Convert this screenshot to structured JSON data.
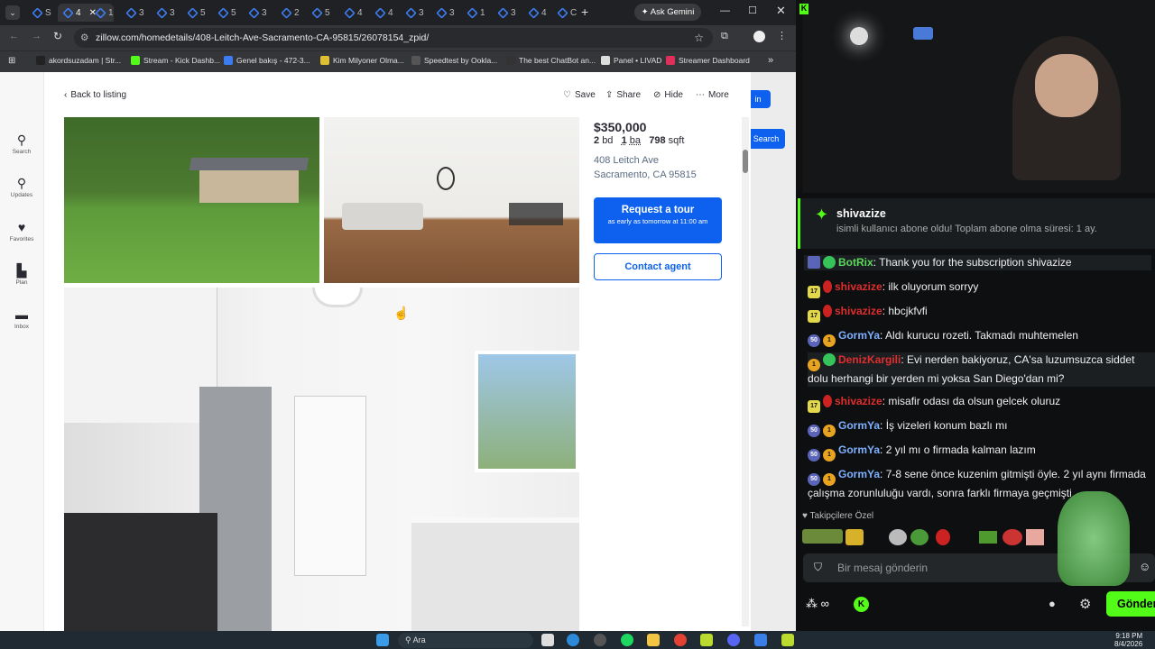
{
  "browser": {
    "tabs": [
      "S",
      "4",
      "1",
      "3",
      "3",
      "5",
      "5",
      "3",
      "2",
      "5",
      "4",
      "4",
      "3",
      "3",
      "1",
      "3",
      "4",
      "C"
    ],
    "gemini": "Ask Gemini",
    "url": "zillow.com/homedetails/408-Leitch-Ave-Sacramento-CA-95815/26078154_zpid/",
    "bookmarks": [
      "akordsuzadam | Str...",
      "Stream - Kick Dashb...",
      "Genel bakış - 472-3...",
      "Kim Milyoner Olma...",
      "Speedtest by Ookla...",
      "The best ChatBot an...",
      "Panel • LIVAD",
      "Streamer Dashboard"
    ]
  },
  "leftnav": [
    "Search",
    "Updates",
    "Favorites",
    "Plan",
    "Inbox"
  ],
  "modal": {
    "back": "Back to listing",
    "actions": [
      "Save",
      "Share",
      "Hide",
      "More"
    ],
    "price": "$350,000",
    "beds": "2",
    "beds_unit": "bd",
    "baths": "1",
    "baths_unit": "ba",
    "sqft": "798",
    "sqft_unit": "sqft",
    "addr1": "408 Leitch Ave",
    "addr2": "Sacramento, CA 95815",
    "tour": "Request a tour",
    "tour_sub": "as early as tomorrow at 11:00 am",
    "agent": "Contact agent"
  },
  "behind": {
    "signin": "in",
    "search": "Search"
  },
  "chat": {
    "sub_user": "shivazize",
    "sub_text": "isimli kullanıcı abone oldu! Toplam abone olma süresi: 1 ay.",
    "messages": [
      {
        "user": "BotRix",
        "text": ": Thank you for the subscription shivazize",
        "color": "#5cd85c"
      },
      {
        "user": "shivazize",
        "text": ": ilk oluyorum sorryy",
        "color": "#e02e2e",
        "badge": "17"
      },
      {
        "user": "shivazize",
        "text": ": hbcjkfvfi",
        "color": "#e02e2e",
        "badge": "17"
      },
      {
        "user": "GormYa",
        "text": ": Aldı kurucu rozeti. Takmadı muhtemelen",
        "color": "#7fb0ff",
        "badge": "50"
      },
      {
        "user": "DenizKargili",
        "text": ": Evi nerden bakiyoruz, CA'sa luzumsuzca siddet dolu herhangi bir yerden mi yoksa San Diego'dan mi?",
        "color": "#e02e2e"
      },
      {
        "user": "shivazize",
        "text": ": misafir odası da olsun gelcek oluruz",
        "color": "#e02e2e",
        "badge": "17"
      },
      {
        "user": "GormYa",
        "text": ": İş vizeleri konum bazlı mı",
        "color": "#7fb0ff",
        "badge": "50"
      },
      {
        "user": "GormYa",
        "text": ": 2 yıl mı o firmada kalman lazım",
        "color": "#7fb0ff",
        "badge": "50"
      },
      {
        "user": "GormYa",
        "text": ": 7-8 sene önce kuzenim gitmişti öyle. 2 yıl aynı firmada çalışma zorunluluğu vardı, sonra farklı firmaya geçmişti",
        "color": "#7fb0ff",
        "badge": "50"
      }
    ],
    "followers": "Takipçilere Özel",
    "placeholder": "Bir mesaj gönderin",
    "send": "Gönder"
  },
  "taskbar": {
    "search": "Ara",
    "time": "9:18 PM",
    "date": "8/4/2026"
  }
}
